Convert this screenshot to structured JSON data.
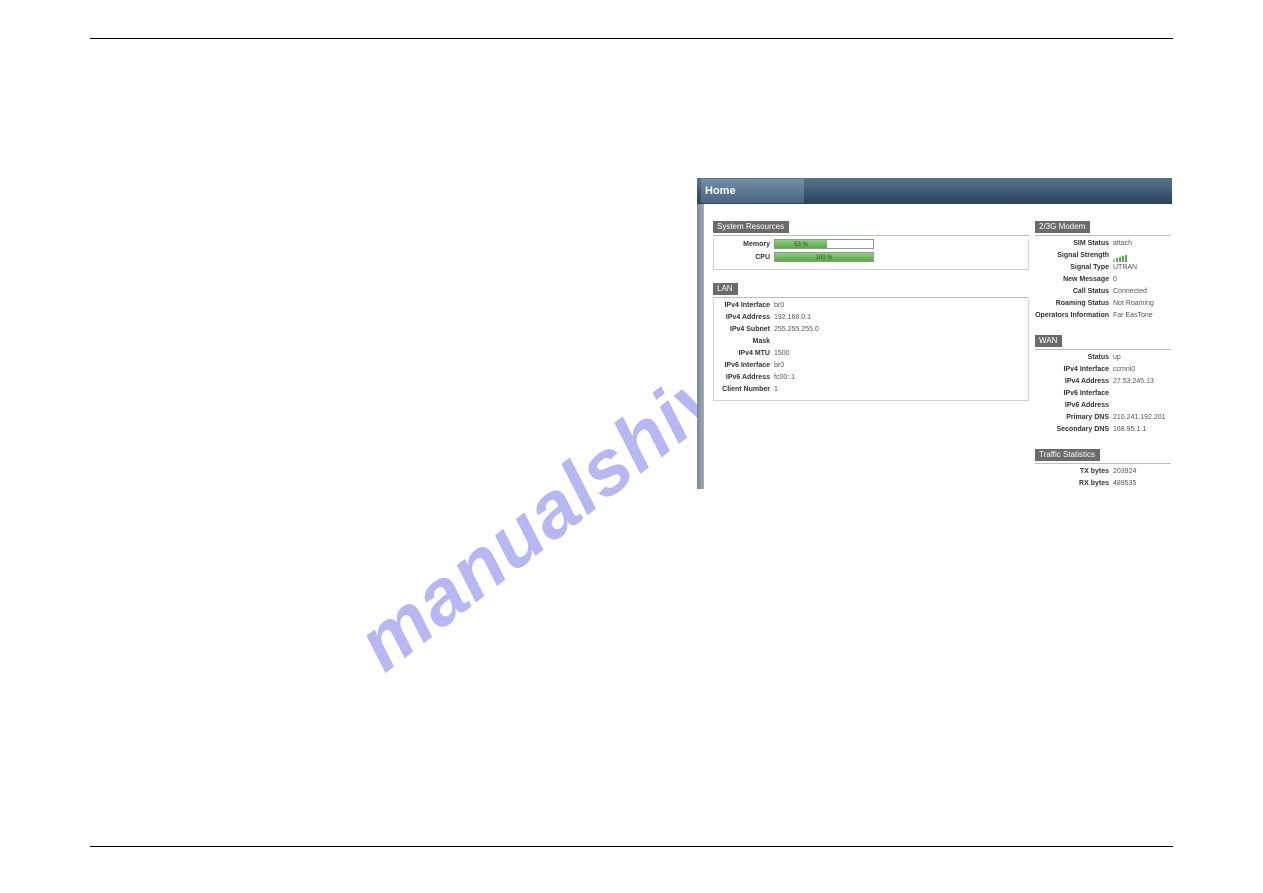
{
  "watermark": "manualshive.com",
  "nav": {
    "tab": "Home"
  },
  "system_resources": {
    "title": "System Resources",
    "memory_label": "Memory",
    "memory_pct": "53 %",
    "memory_fill": 53,
    "cpu_label": "CPU",
    "cpu_pct": "100 %",
    "cpu_fill": 100
  },
  "lan": {
    "title": "LAN",
    "rows": [
      {
        "k": "IPv4 Interface",
        "v": "br0"
      },
      {
        "k": "IPv4 Address",
        "v": "192.168.0.1"
      },
      {
        "k": "IPv4 Subnet Mask",
        "v": "255.255.255.0"
      },
      {
        "k": "IPv4 MTU",
        "v": "1500"
      },
      {
        "k": "IPv6 Interface",
        "v": "br0"
      },
      {
        "k": "IPv6 Address",
        "v": "fc00::1"
      },
      {
        "k": "Client Number",
        "v": "1"
      }
    ]
  },
  "modem": {
    "title": "2/3G Modem",
    "rows": [
      {
        "k": "SIM Status",
        "v": "attach"
      },
      {
        "k": "Signal Strength",
        "v": "__SIGNAL__"
      },
      {
        "k": "Signal Type",
        "v": "UTRAN"
      },
      {
        "k": "New Message",
        "v": "0"
      },
      {
        "k": "Call Status",
        "v": "Connected"
      },
      {
        "k": "Roaming Status",
        "v": "Not Roaming"
      },
      {
        "k": "Operators Information",
        "v": "Far EasTone"
      }
    ]
  },
  "wan": {
    "title": "WAN",
    "rows": [
      {
        "k": "Status",
        "v": "up"
      },
      {
        "k": "IPv4 Interface",
        "v": "ccmni0"
      },
      {
        "k": "IPv4 Address",
        "v": "27.53.245.13"
      },
      {
        "k": "IPv6 Interface",
        "v": ""
      },
      {
        "k": "IPv6 Address",
        "v": ""
      },
      {
        "k": "Primary DNS",
        "v": "210.241.192.201"
      },
      {
        "k": "Secondary DNS",
        "v": "168.95.1.1"
      }
    ]
  },
  "traffic": {
    "title": "Traffic Statistics",
    "rows": [
      {
        "k": "TX bytes",
        "v": "203924"
      },
      {
        "k": "RX bytes",
        "v": "489535"
      }
    ]
  }
}
